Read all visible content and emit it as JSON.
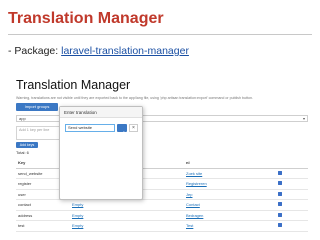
{
  "slide": {
    "title": "Translation Manager",
    "subtitle_prefix": "- Package: ",
    "subtitle_link": "laravel-translation-manager"
  },
  "app": {
    "title": "Translation Manager",
    "info_line": "Warning, translations are not visible until they are exported back to the app/lang file, using 'php artisan translation:export' command or publish button.",
    "import_button": "Import groups",
    "group_select_placeholder": "app",
    "keys_placeholder": "Add 1 key per line",
    "add_keys_button": "Add keys",
    "total_line": "Total: 6",
    "popover": {
      "title": "Enter translation",
      "input_value": "Send website",
      "cancel_label": "×"
    },
    "table": {
      "headers": [
        "Key",
        "en",
        "nl",
        ""
      ],
      "rows": [
        {
          "key": "send_website",
          "en": "Send website",
          "nl": "Zoek site"
        },
        {
          "key": "register",
          "en": "Empty",
          "nl": "Registreren"
        },
        {
          "key": "user",
          "en": "Empty",
          "nl": "Jep"
        },
        {
          "key": "contact",
          "en": "Empty",
          "nl": "Contact"
        },
        {
          "key": "address",
          "en": "Empty",
          "nl": "Bedragen"
        },
        {
          "key": "test",
          "en": "Empty",
          "nl": "Test"
        }
      ]
    }
  },
  "colors": {
    "title_red": "#c0392b",
    "link_blue": "#1a4fa3",
    "primary": "#3b78c4"
  }
}
